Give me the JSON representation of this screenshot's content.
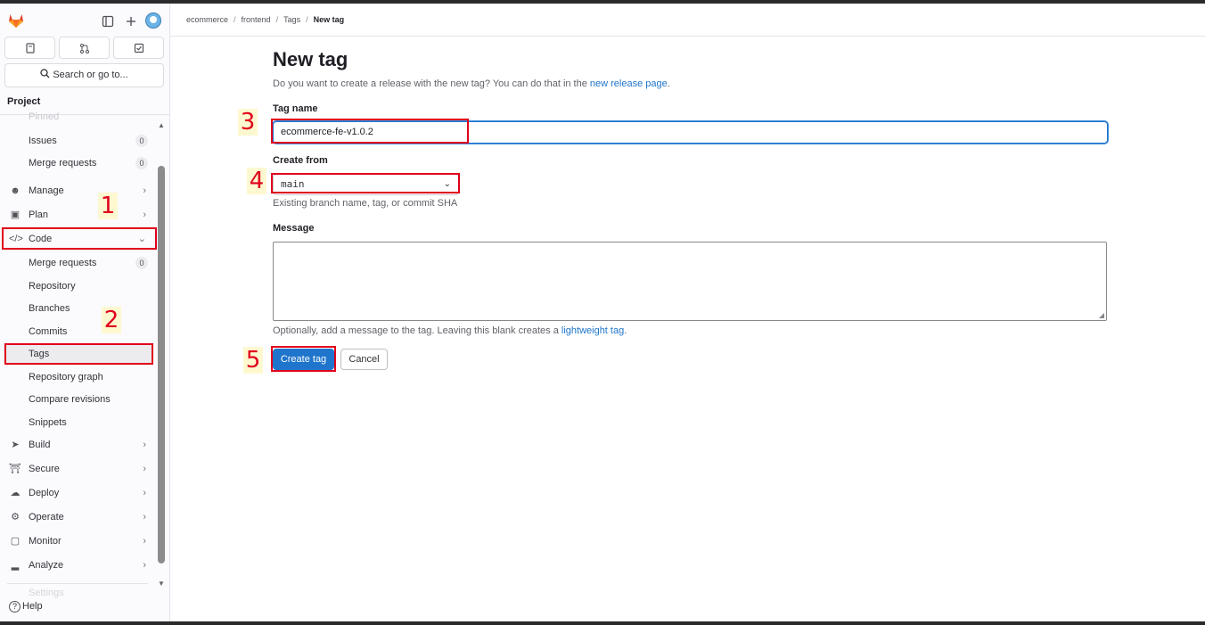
{
  "sidebar": {
    "search_label": "Search or go to...",
    "section_title": "Project",
    "faded_top": "Pinned",
    "items": [
      {
        "label": "Issues",
        "badge": "0"
      },
      {
        "label": "Merge requests",
        "badge": "0"
      },
      {
        "label": "Manage"
      },
      {
        "label": "Plan"
      },
      {
        "label": "Code"
      },
      {
        "label": "Merge requests",
        "badge": "0"
      },
      {
        "label": "Repository"
      },
      {
        "label": "Branches"
      },
      {
        "label": "Commits"
      },
      {
        "label": "Tags"
      },
      {
        "label": "Repository graph"
      },
      {
        "label": "Compare revisions"
      },
      {
        "label": "Snippets"
      },
      {
        "label": "Build"
      },
      {
        "label": "Secure"
      },
      {
        "label": "Deploy"
      },
      {
        "label": "Operate"
      },
      {
        "label": "Monitor"
      },
      {
        "label": "Analyze"
      }
    ],
    "faded_bottom": "Settings",
    "help_label": "Help"
  },
  "breadcrumb": {
    "items": [
      "ecommerce",
      "frontend",
      "Tags"
    ],
    "current": "New tag",
    "separator": "/"
  },
  "page": {
    "title": "New tag",
    "subtitle_prefix": "Do you want to create a release with the new tag? You can do that in the ",
    "subtitle_link": "new release page",
    "subtitle_suffix": "."
  },
  "form": {
    "tag_name_label": "Tag name",
    "tag_name_value": "ecommerce-fe-v1.0.2",
    "create_from_label": "Create from",
    "create_from_value": "main",
    "create_from_hint": "Existing branch name, tag, or commit SHA",
    "message_label": "Message",
    "message_hint_prefix": "Optionally, add a message to the tag. Leaving this blank creates a ",
    "message_hint_link": "lightweight tag",
    "message_hint_suffix": ".",
    "create_button": "Create tag",
    "cancel_button": "Cancel"
  },
  "annotations": [
    "1",
    "2",
    "3",
    "4",
    "5"
  ],
  "colors": {
    "accent": "#1f75cb",
    "annotation_red": "#e0001b",
    "annotation_bg": "#fdf8d0"
  }
}
